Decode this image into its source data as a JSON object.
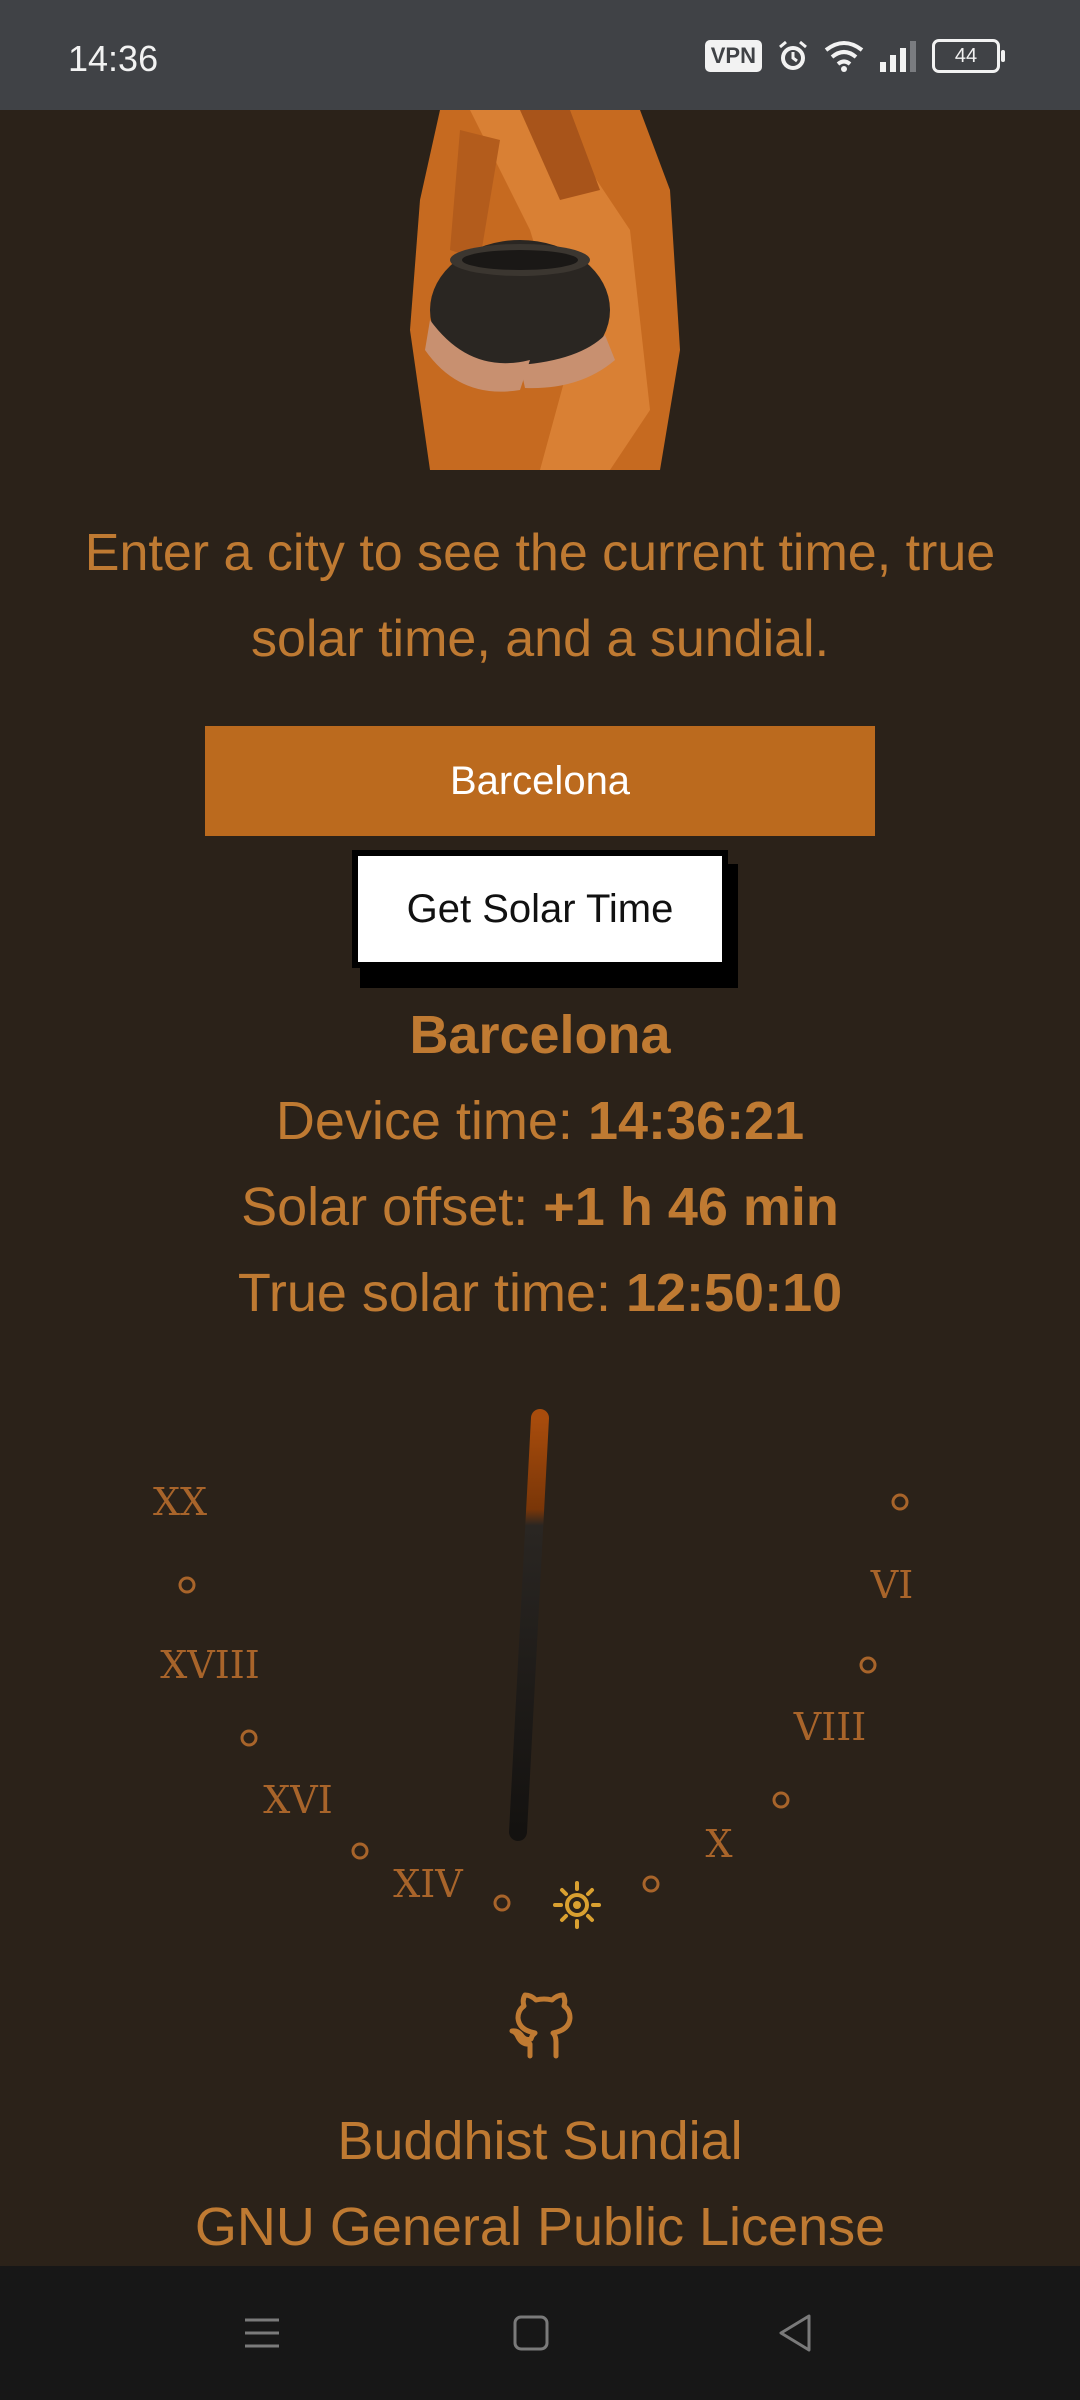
{
  "status": {
    "time": "14:36",
    "vpn": "VPN",
    "battery": "44"
  },
  "intro": {
    "text": "Enter a city to see the current time, true solar time, and a sundial."
  },
  "search": {
    "value": "Barcelona",
    "button_label": "Get Solar Time"
  },
  "result": {
    "city": "Barcelona",
    "device_label": "Device time: ",
    "device_value": "14:36:21",
    "offset_label": "Solar offset: ",
    "offset_value": "+1 h 46 min",
    "true_label": "True solar time: ",
    "true_value": "12:50:10"
  },
  "sundial": {
    "hour_labels": [
      "XX",
      "XVIII",
      "XVI",
      "XIV",
      "X",
      "VIII",
      "VI"
    ],
    "sun_icon": "sun-icon"
  },
  "footer": {
    "title": "Buddhist Sundial",
    "license": "GNU General Public License",
    "icon": "github-icon"
  },
  "colors": {
    "background": "#2b2219",
    "accent": "#bf7a32",
    "input": "#bb6a1e"
  }
}
